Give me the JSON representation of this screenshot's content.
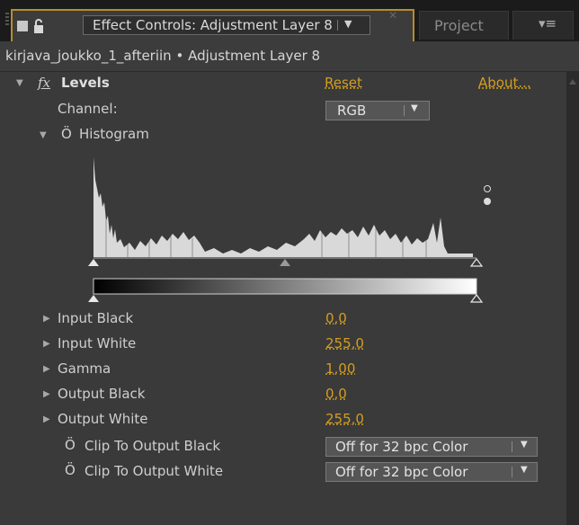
{
  "tabs": {
    "effect_controls_title": "Effect Controls: Adjustment Layer 8",
    "project_label": "Project"
  },
  "breadcrumb": "kirjava_joukko_1_afteriin • Adjustment Layer 8",
  "effect": {
    "fx": "fx",
    "name": "Levels",
    "reset": "Reset",
    "about": "About..."
  },
  "channel": {
    "label": "Channel:",
    "value": "RGB"
  },
  "histogram": {
    "label": "Histogram"
  },
  "params": [
    {
      "label": "Input Black",
      "value": "0,0"
    },
    {
      "label": "Input White",
      "value": "255,0"
    },
    {
      "label": "Gamma",
      "value": "1,00"
    },
    {
      "label": "Output Black",
      "value": "0,0"
    },
    {
      "label": "Output White",
      "value": "255,0"
    }
  ],
  "clip": [
    {
      "label": "Clip To Output Black",
      "value": "Off for 32 bpc Color"
    },
    {
      "label": "Clip To Output White",
      "value": "Off for 32 bpc Color"
    }
  ],
  "colors": {
    "accent": "#d39e1f",
    "panel": "#3a3a3a",
    "focus_border": "#b58d2e"
  },
  "icons": [
    "panel-grip-icon",
    "panel-square-icon",
    "lock-icon",
    "dropdown-arrow-icon",
    "close-icon",
    "panel-menu-icon",
    "stopwatch-icon",
    "expand-triangle-icon"
  ]
}
